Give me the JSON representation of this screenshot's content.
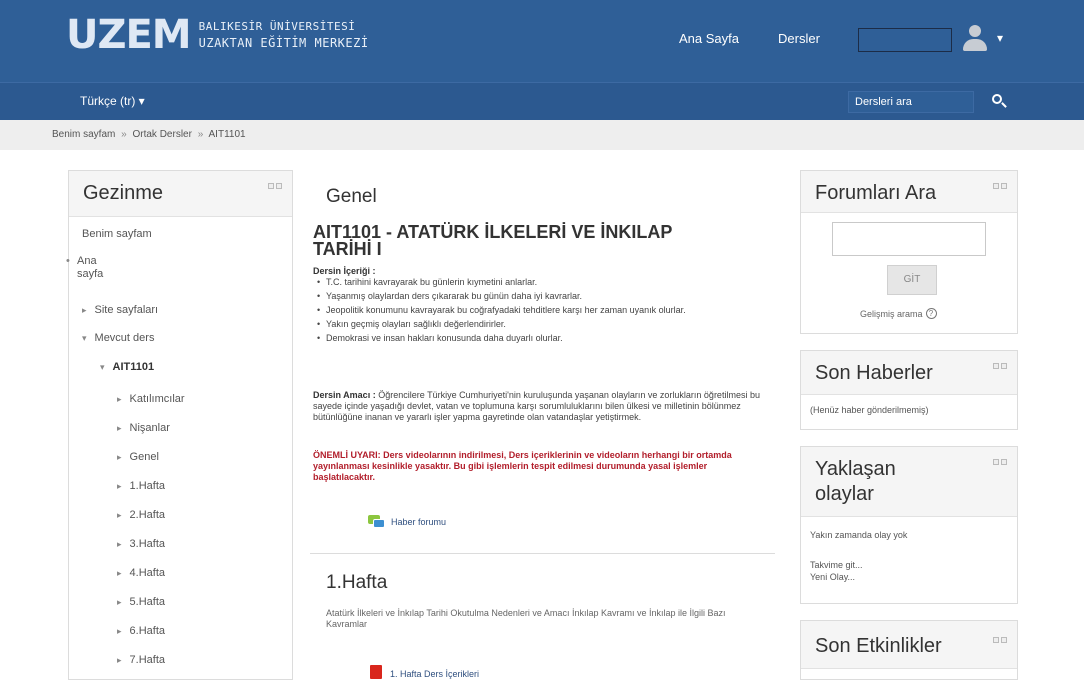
{
  "header": {
    "logo_mark": "UZEM",
    "logo_line1": "BALIKESİR ÜNİVERSİTESİ",
    "logo_line2": "UZAKTAN EĞİTİM MERKEZİ",
    "nav_home": "Ana Sayfa",
    "nav_courses": "Dersler",
    "user_caret": "▾"
  },
  "subbar": {
    "language": "Türkçe (tr) ▾",
    "search_value": "Dersleri ara"
  },
  "breadcrumb": [
    "Benim sayfam",
    "Ortak Dersler",
    "AIT1101"
  ],
  "breadcrumb_sep": "»",
  "left_block": {
    "title": "Gezinme",
    "items": {
      "my_page": "Benim sayfam",
      "home_1": "Ana",
      "home_2": "sayfa",
      "site_pages": "Site sayfaları",
      "current_course": "Mevcut ders",
      "course_code": "AIT1101",
      "participants": "Katılımcılar",
      "badges": "Nişanlar",
      "general": "Genel",
      "week1": "1.Hafta",
      "week2": "2.Hafta",
      "week3": "3.Hafta",
      "week4": "4.Hafta",
      "week5": "5.Hafta",
      "week6": "6.Hafta",
      "week7": "7.Hafta"
    }
  },
  "main": {
    "section_general": "Genel",
    "course_title": "AIT1101 - ATATÜRK İLKELERİ VE İNKILAP TARİHİ I",
    "content_label": "Dersin İçeriği :",
    "content_items": [
      "T.C. tarihini kavrayarak bu günlerin kıymetini anlarlar.",
      "Yaşanmış olaylardan ders çıkararak bu günün daha iyi kavrarlar.",
      "Jeopolitik konumunu kavrayarak bu coğrafyadaki tehditlere karşı her zaman uyanık olurlar.",
      "Yakın geçmiş olayları sağlıklı değerlendirirler.",
      "Demokrasi ve insan hakları konusunda daha duyarlı olurlar."
    ],
    "purpose_label": "Dersin Amacı :",
    "purpose_text": "Öğrencilere Türkiye Cumhuriyeti'nin kuruluşunda yaşanan olayların ve zorlukların öğretilmesi bu sayede içinde yaşadığı devlet, vatan ve toplumuna karşı sorumluluklarını bilen ülkesi ve milletinin bölünmez bütünlüğüne inanan ve yararlı işler yapma gayretinde olan vatandaşlar yetiştirmek.",
    "warning": "ÖNEMLİ UYARI: Ders videolarının indirilmesi, Ders içeriklerinin ve videoların herhangi bir ortamda yayınlanması kesinlikle yasaktır. Bu gibi işlemlerin tespit edilmesi durumunda yasal işlemler başlatılacaktır.",
    "news_forum": "Haber forumu",
    "section_week1": "1.Hafta",
    "week1_summary": "Atatürk İlkeleri ve İnkılap Tarihi Okutulma Nedenleri ve Amacı İnkılap Kavramı ve İnkılap ile İlgili Bazı Kavramlar",
    "week1_content": "1. Hafta Ders İçerikleri"
  },
  "right": {
    "forum_title": "Forumları Ara",
    "go_label": "GİT",
    "advanced_search": "Gelişmiş arama",
    "news_title": "Son Haberler",
    "news_empty": "(Henüz haber gönderilmemiş)",
    "upcoming_title_1": "Yaklaşan",
    "upcoming_title_2": "olaylar",
    "upcoming_empty": "Yakın zamanda olay yok",
    "goto_calendar": "Takvime git...",
    "new_event": "Yeni Olay...",
    "recent_title": "Son Etkinlikler"
  },
  "colors": {
    "header": "#2f5f97",
    "subbar": "#2c5990",
    "warning": "#b21e2b"
  }
}
